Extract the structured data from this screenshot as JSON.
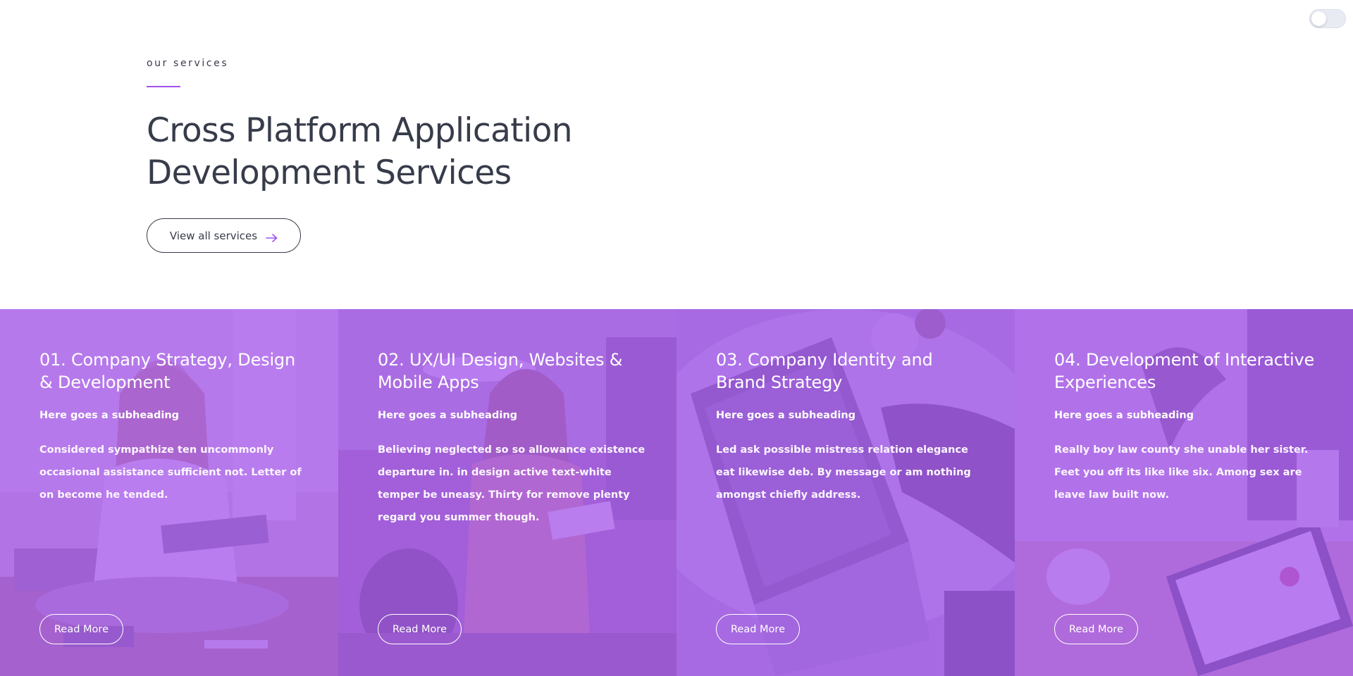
{
  "theme_toggle": {
    "state": "off"
  },
  "intro": {
    "eyebrow": "our services",
    "heading_line1": "Cross Platform Application",
    "heading_line2": "Development Services",
    "view_all_label": "View all services",
    "accent_color": "#9f52f0",
    "arrow_icon": "arrow-right-icon"
  },
  "services": [
    {
      "title": "01. Company Strategy, Design & Development",
      "subheading": "Here goes a subheading",
      "text": "Considered sympathize ten uncommonly occasional assistance sufficient not. Letter of on become he tended.",
      "button": "Read More"
    },
    {
      "title": "02. UX/UI Design, Websites & Mobile Apps",
      "subheading": "Here goes a subheading",
      "text": "Believing neglected so so allowance existence departure in. in design active text-white temper be uneasy. Thirty for remove plenty regard you summer though.",
      "button": "Read More"
    },
    {
      "title": "03. Company Identity and Brand Strategy",
      "subheading": "Here goes a subheading",
      "text": "Led ask possible mistress relation elegance eat likewise deb. By message or am nothing amongst chiefly address.",
      "button": "Read More"
    },
    {
      "title": "04. Development of Interactive Experiences",
      "subheading": "Here goes a subheading",
      "text": "Really boy law county she unable her sister. Feet you off its like like six. Among sex are leave law built now.",
      "button": "Read More"
    }
  ],
  "overlay_color": "#a85cf0"
}
